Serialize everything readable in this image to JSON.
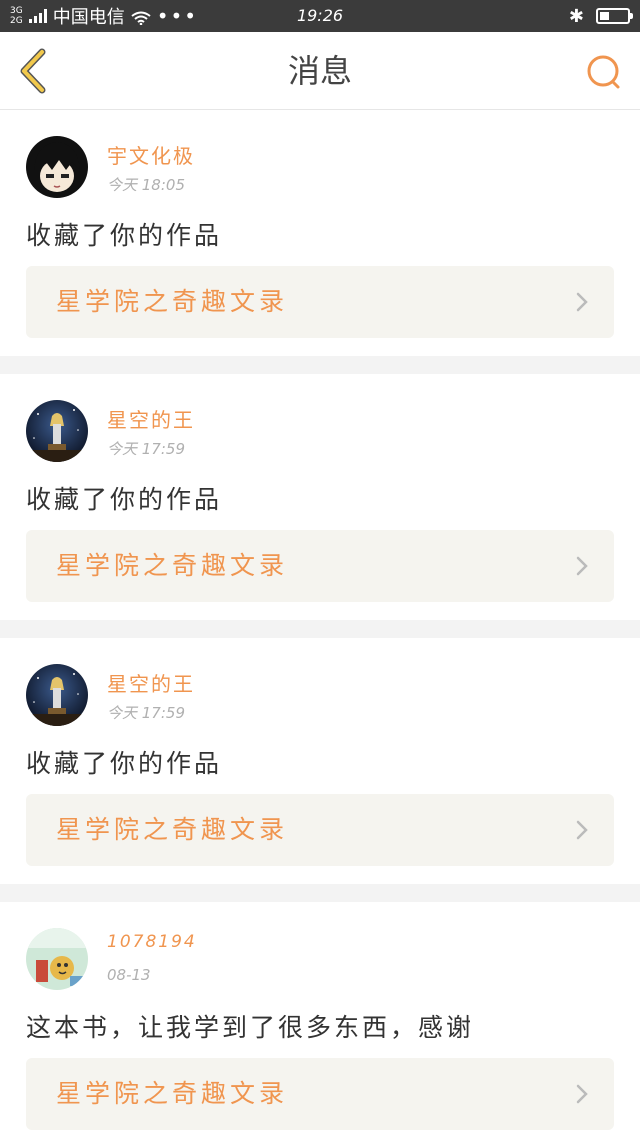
{
  "status_bar": {
    "network_top": "3G",
    "network_bottom": "2G",
    "carrier": "中国电信",
    "more": "•••",
    "time": "19:26",
    "bluetooth": "✱",
    "battery_level": 0.35
  },
  "header": {
    "title": "消息",
    "back_icon": "chevron-left-icon",
    "search_icon": "search-icon"
  },
  "colors": {
    "accent": "#f0954f",
    "back_arrow": "#f2c94c",
    "card_bar_bg": "#f5f4ef"
  },
  "messages": [
    {
      "username": "宇文化极",
      "time": "今天 18:05",
      "text": "收藏了你的作品",
      "book": "星学院之奇趣文录",
      "avatar": "anime-boy-avatar"
    },
    {
      "username": "星空的王",
      "time": "今天 17:59",
      "text": "收藏了你的作品",
      "book": "星学院之奇趣文录",
      "avatar": "starry-night-avatar"
    },
    {
      "username": "星空的王",
      "time": "今天 17:59",
      "text": "收藏了你的作品",
      "book": "星学院之奇趣文录",
      "avatar": "starry-night-avatar"
    },
    {
      "username": "1078194",
      "time": "08-13",
      "text": "这本书，让我学到了很多东西，感谢",
      "book": "星学院之奇趣文录",
      "avatar": "cartoon-avatar"
    }
  ]
}
